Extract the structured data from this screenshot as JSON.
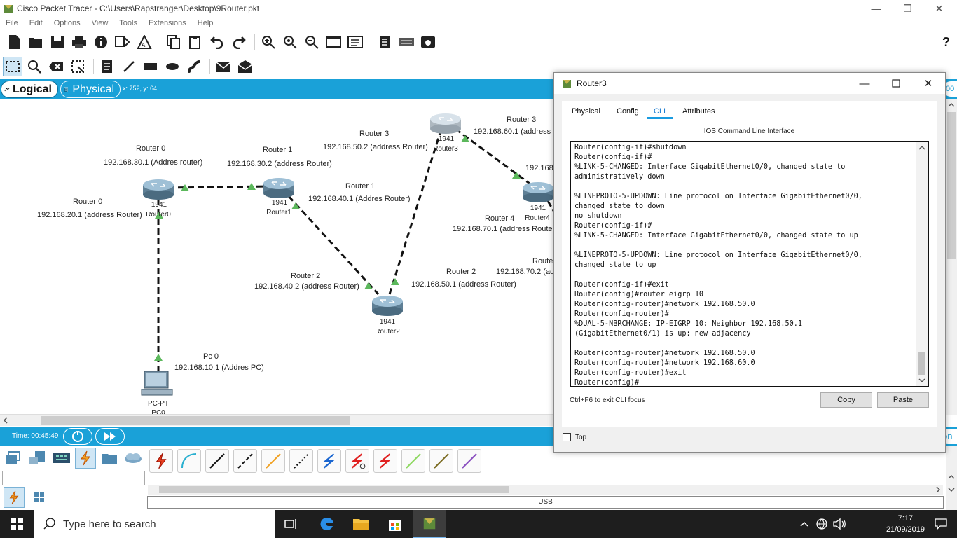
{
  "window": {
    "title": "Cisco Packet Tracer - C:\\Users\\Rapstranger\\Desktop\\9Router.pkt",
    "minimize": "—",
    "maximize": "❐",
    "close": "✕"
  },
  "menu": [
    "File",
    "Edit",
    "Options",
    "View",
    "Tools",
    "Extensions",
    "Help"
  ],
  "toolbar": {
    "help_label": "?"
  },
  "mode": {
    "logical_label": "Logical",
    "physical_label": "Physical",
    "coords": "x: 752, y: 64",
    "right_fragment": "00"
  },
  "topology": {
    "devices": [
      {
        "id": "router0",
        "model": "1941",
        "name": "Router0"
      },
      {
        "id": "router1",
        "model": "1941",
        "name": "Router1"
      },
      {
        "id": "router2",
        "model": "1941",
        "name": "Router2"
      },
      {
        "id": "router3",
        "model": "1941",
        "name": "Router3"
      },
      {
        "id": "router4",
        "model": "1941",
        "name": "Router4"
      },
      {
        "id": "pc0",
        "model": "PC-PT",
        "name": "PC0"
      }
    ],
    "notes": [
      "Router 0",
      "192.168.30.1 (Addres router)",
      "Router 0",
      "192.168.20.1 (address Router)",
      "Router 1",
      "192.168.30.2 (address Router)",
      "Router 1",
      "192.168.40.1 (Addres Router)",
      "Router 3",
      "192.168.50.2 (address Router)",
      "Router 3",
      "192.168.60.1 (address",
      "192.168.",
      "Router 4",
      "192.168.70.1 (address Router",
      "Router",
      "192.168.70.2 (ad",
      "Router 2",
      "192.168.40.2 (address Router)",
      "Router 2",
      "192.168.50.1 (address Router)",
      "Pc 0",
      "192.168.10.1 (Addres PC)"
    ]
  },
  "timebar": {
    "time": "Time: 00:45:49",
    "right_fragment": "on"
  },
  "palette": {
    "usb_label": "USB"
  },
  "dialog": {
    "title": "Router3",
    "tabs": [
      "Physical",
      "Config",
      "CLI",
      "Attributes"
    ],
    "active_tab": "CLI",
    "heading": "IOS Command Line Interface",
    "cli_lines": [
      "Router(config-if)#shutdown",
      "Router(config-if)#",
      "%LINK-5-CHANGED: Interface GigabitEthernet0/0, changed state to",
      "administratively down",
      "",
      "%LINEPROTO-5-UPDOWN: Line protocol on Interface GigabitEthernet0/0,",
      "changed state to down",
      "no shutdown",
      "Router(config-if)#",
      "%LINK-5-CHANGED: Interface GigabitEthernet0/0, changed state to up",
      "",
      "%LINEPROTO-5-UPDOWN: Line protocol on Interface GigabitEthernet0/0,",
      "changed state to up",
      "",
      "Router(config-if)#exit",
      "Router(config)#router eigrp 10",
      "Router(config-router)#network 192.168.50.0",
      "Router(config-router)#",
      "%DUAL-5-NBRCHANGE: IP-EIGRP 10: Neighbor 192.168.50.1",
      "(GigabitEthernet0/1) is up: new adjacency",
      "",
      "Router(config-router)#network 192.168.50.0",
      "Router(config-router)#network 192.168.60.0",
      "Router(config-router)#exit",
      "Router(config)#"
    ],
    "hint": "Ctrl+F6 to exit CLI focus",
    "copy_label": "Copy",
    "paste_label": "Paste",
    "top_label": "Top",
    "top_checked": false
  },
  "taskbar": {
    "search_placeholder": "Type here to search",
    "time": "7:17",
    "date": "21/09/2019"
  },
  "colors": {
    "accent": "#1aa1d8",
    "link_green": "#5cb85c",
    "taskbar": "#1e1e1e"
  }
}
